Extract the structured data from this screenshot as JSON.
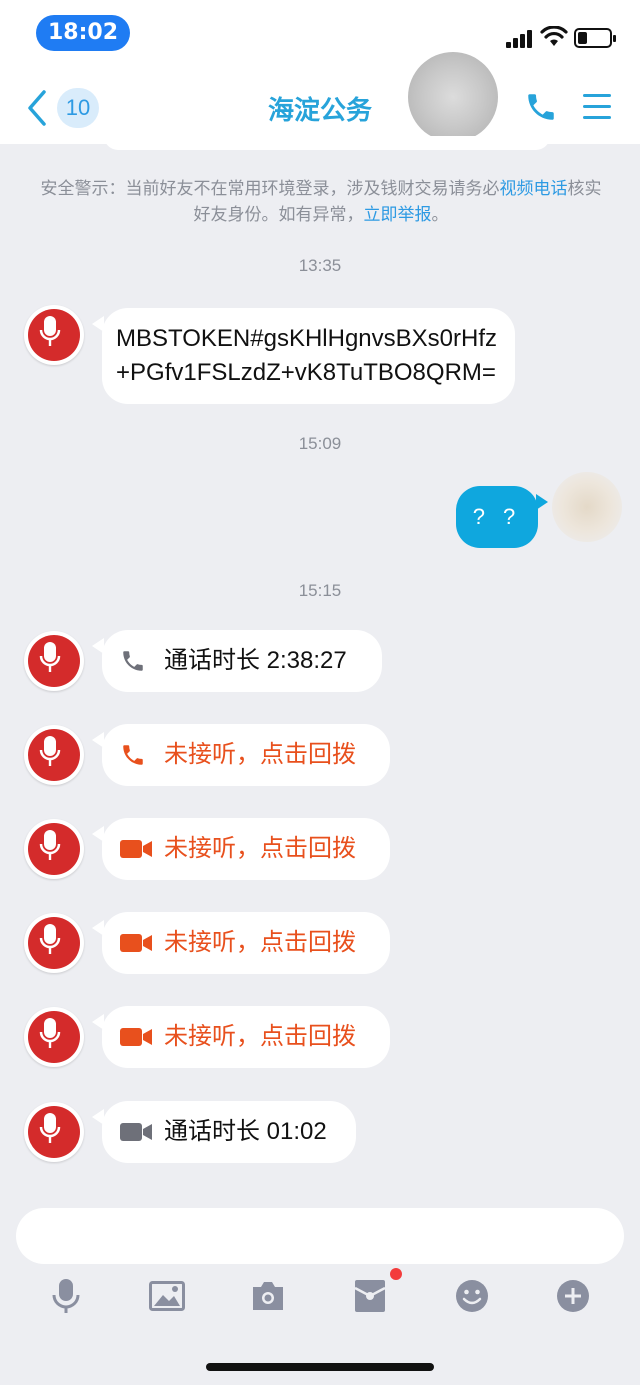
{
  "status": {
    "time": "18:02"
  },
  "header": {
    "back_count": "10",
    "title": "海淀公务"
  },
  "warning": {
    "prefix": "安全警示：当前好友不在常用环境登录，涉及钱财交易请务必",
    "link1": "视频电话",
    "middle": "核实好友身份。如有异常，",
    "link2": "立即举报",
    "suffix": "。"
  },
  "messages": {
    "ts1": "13:35",
    "token_line1": "MBSTOKEN#gsKHlHgnvsBXs0rHfz",
    "token_line2": "+PGfv1FSLzdZ+vK8TuTBO8QRM=",
    "ts2": "15:09",
    "outgoing": "? ?",
    "ts3": "15:15",
    "call1": "通话时长 2:38:27",
    "missed1": "未接听，点击回拨",
    "missed2": "未接听，点击回拨",
    "missed3": "未接听，点击回拨",
    "missed4": "未接听，点击回拨",
    "call2": "通话时长 01:02"
  },
  "colors": {
    "accent": "#27a3da",
    "missed": "#e8501d",
    "outgoing": "#0fa7de",
    "avatar": "#d42b2b"
  },
  "toolbar": [
    "mic-icon",
    "image-icon",
    "camera-icon",
    "red-packet-icon",
    "emoji-icon",
    "plus-icon"
  ]
}
